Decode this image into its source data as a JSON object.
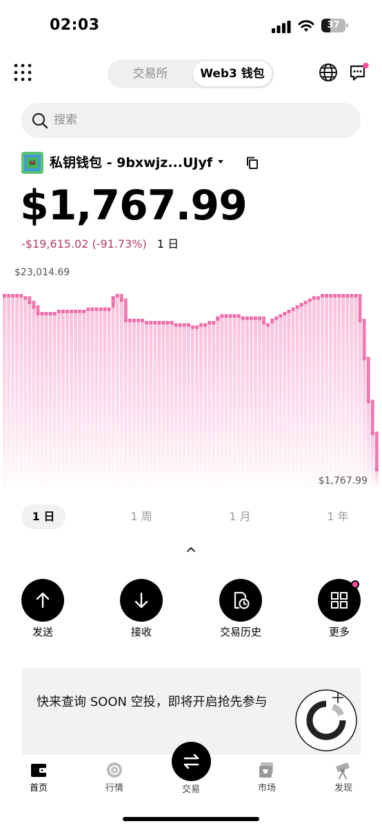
{
  "status_bar": {
    "time": "02:03",
    "battery": "37",
    "battery_level": 0.37
  },
  "header": {
    "tabs": [
      {
        "label": "交易所",
        "active": false
      },
      {
        "label": "Web3 钱包",
        "active": true
      }
    ],
    "icons": [
      "grid-menu-icon",
      "globe-icon",
      "message-icon"
    ],
    "message_has_badge": true
  },
  "search": {
    "placeholder": "搜索"
  },
  "wallet": {
    "name": "私钥钱包 - 9bxwjz...UJyf",
    "balance": "$1,767.99",
    "change": "-$19,615.02 (-91.73%)",
    "change_period": "1 日",
    "colors": {
      "negative": "#b33a5e",
      "accent": "#ff4fa0"
    }
  },
  "chart": {
    "max_label": "$23,014.69",
    "min_label": "$1,767.99",
    "range_tabs": [
      {
        "label": "1 日",
        "active": true
      },
      {
        "label": "1 周",
        "active": false
      },
      {
        "label": "1 月",
        "active": false
      },
      {
        "label": "1 年",
        "active": false
      }
    ]
  },
  "chart_data": {
    "type": "area",
    "color": "#f06aa9",
    "ylim": [
      1767.99,
      23014.69
    ],
    "max": 23014.69,
    "min": 1767.99,
    "y": [
      23014.69,
      23014.69,
      23014.69,
      23014.69,
      23014.69,
      22736,
      22186,
      21636,
      20810,
      20810,
      20810,
      20810,
      20810,
      21085,
      21085,
      21085,
      21085,
      21085,
      21085,
      21085,
      21360,
      21360,
      21360,
      21360,
      21360,
      21360,
      22736,
      23014.69,
      22461,
      19984,
      19984,
      19984,
      19984,
      19984,
      19709,
      19709,
      19709,
      19709,
      19709,
      19709,
      19709,
      19434,
      19434,
      19434,
      19434,
      19159,
      19159,
      19434,
      19434,
      19709,
      19709,
      20260,
      20535,
      20535,
      20535,
      20535,
      20535,
      20260,
      20260,
      20260,
      20260,
      20260,
      19709,
      19434,
      19984,
      20260,
      20535,
      20810,
      21085,
      21360,
      21636,
      21910,
      22186,
      22461,
      22736,
      22736,
      23014.69,
      23014.69,
      23014.69,
      23014.69,
      23014.69,
      23014.69,
      23014.69,
      23014.69,
      23014.69,
      19984,
      15331,
      10095,
      6190,
      1767.99
    ]
  },
  "actions": [
    {
      "label": "发送",
      "icon": "arrow-up-icon"
    },
    {
      "label": "接收",
      "icon": "arrow-down-icon"
    },
    {
      "label": "交易历史",
      "icon": "history-icon"
    },
    {
      "label": "更多",
      "icon": "grid-more-icon",
      "badge": true
    }
  ],
  "promo": {
    "text": "快来查询 SOON 空投，即将开启抢先参与"
  },
  "bottom_nav": [
    {
      "label": "首页",
      "icon": "wallet-home-icon",
      "active": true
    },
    {
      "label": "行情",
      "icon": "market-coin-icon",
      "active": false
    },
    {
      "label": "交易",
      "icon": "swap-icon",
      "active": false
    },
    {
      "label": "市场",
      "icon": "marketplace-icon",
      "active": false
    },
    {
      "label": "发现",
      "icon": "telescope-icon",
      "active": false
    }
  ]
}
